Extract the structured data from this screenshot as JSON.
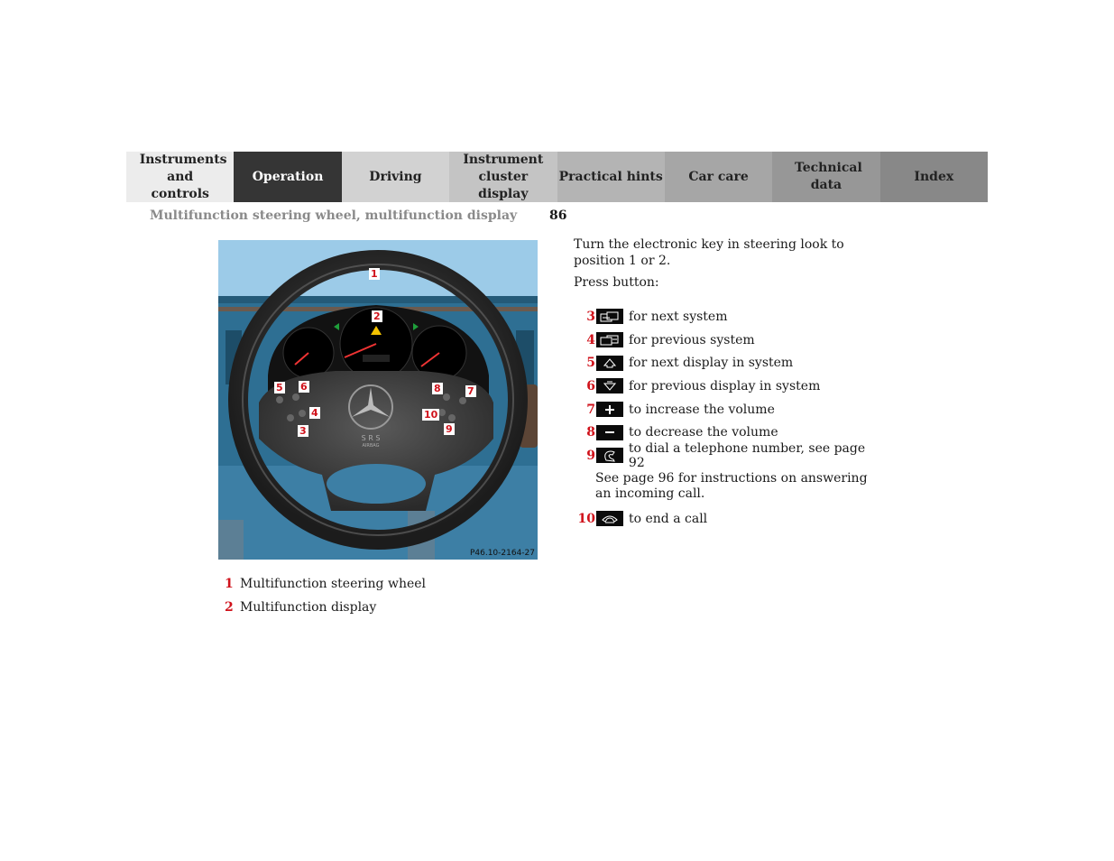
{
  "nav": {
    "tabs": [
      {
        "label": "Instruments and controls",
        "bg": "#ececec",
        "active": false
      },
      {
        "label": "Operation",
        "bg": "#353535",
        "active": true
      },
      {
        "label": "Driving",
        "bg": "#d2d2d2",
        "active": false
      },
      {
        "label": "Instrument cluster display",
        "bg": "#c4c4c4",
        "active": false
      },
      {
        "label": "Practical hints",
        "bg": "#b4b4b4",
        "active": false
      },
      {
        "label": "Car care",
        "bg": "#a6a6a6",
        "active": false
      },
      {
        "label": "Technical data",
        "bg": "#979797",
        "active": false
      },
      {
        "label": "Index",
        "bg": "#888888",
        "active": false
      }
    ]
  },
  "header": {
    "section_title": "Multifunction steering wheel, multifunction display",
    "page_number": "86"
  },
  "figure": {
    "code": "P46.10-2164-27",
    "callouts": [
      "1",
      "2",
      "3",
      "4",
      "5",
      "6",
      "7",
      "8",
      "9",
      "10"
    ],
    "airbag_label": "S R S",
    "airbag_sub": "AIRBAG"
  },
  "legend": [
    {
      "num": "1",
      "text": "Multifunction steering wheel"
    },
    {
      "num": "2",
      "text": "Multifunction display"
    }
  ],
  "instructions": {
    "intro": "Turn the electronic key in steering look to position 1 or 2.",
    "press": "Press button:",
    "buttons": [
      {
        "num": "3",
        "icon": "next-system-icon",
        "text": "for next system"
      },
      {
        "num": "4",
        "icon": "previous-system-icon",
        "text": "for previous system"
      },
      {
        "num": "5",
        "icon": "up-arrow-icon",
        "text": "for next display in system"
      },
      {
        "num": "6",
        "icon": "down-arrow-icon",
        "text": "for previous display in system"
      },
      {
        "num": "7",
        "icon": "plus-icon",
        "text": "to increase the volume"
      },
      {
        "num": "8",
        "icon": "minus-icon",
        "text": "to decrease the volume"
      },
      {
        "num": "9",
        "icon": "phone-dial-icon",
        "text": "to dial a telephone number, see page 92"
      },
      {
        "num": "10",
        "icon": "phone-end-icon",
        "text": "to end a call"
      }
    ],
    "note": "See page 96 for instructions on answering an incoming call."
  }
}
